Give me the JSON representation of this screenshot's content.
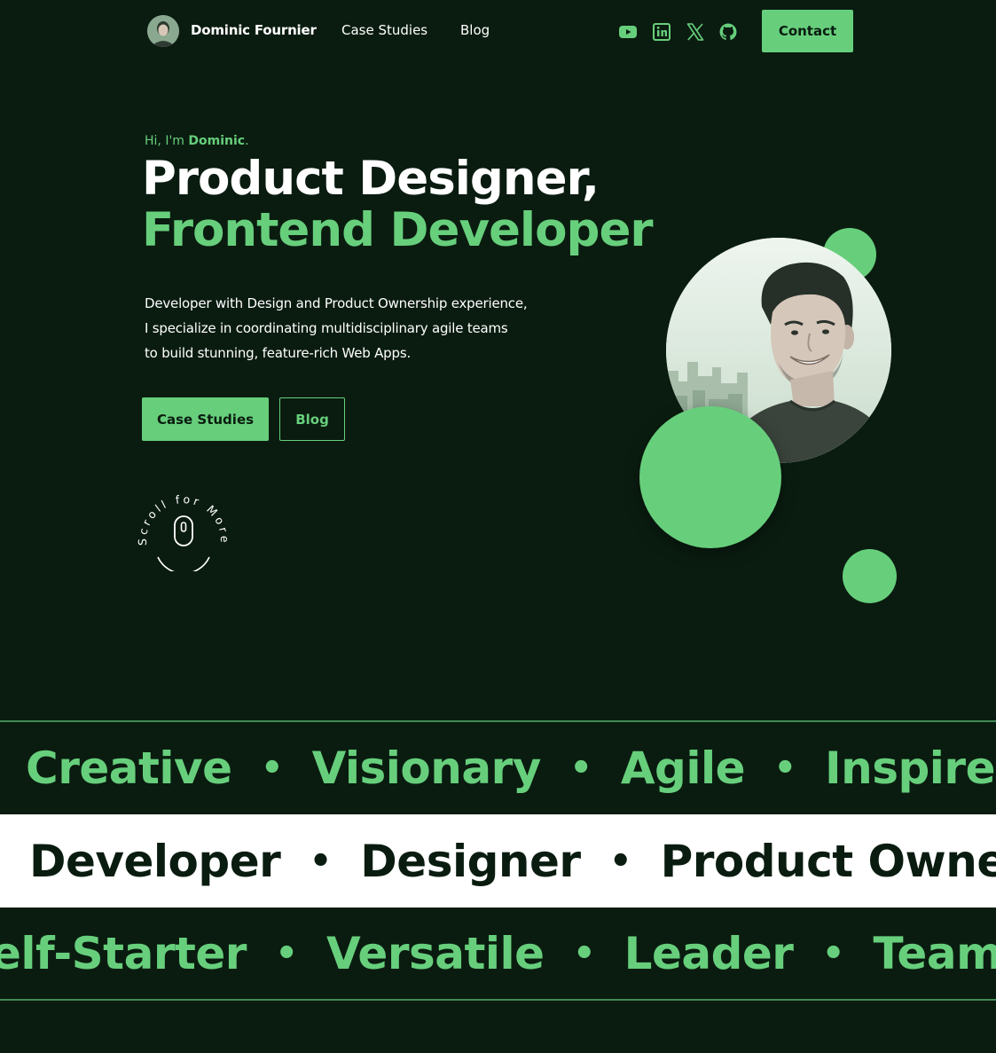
{
  "nav": {
    "brand": "Dominic Fournier",
    "links": [
      "Case Studies",
      "Blog"
    ],
    "socials": [
      "youtube-icon",
      "linkedin-icon",
      "x-icon",
      "github-icon"
    ],
    "contact_label": "Contact"
  },
  "hero": {
    "greeting_prefix": "Hi, I'm ",
    "greeting_name": "Dominic",
    "greeting_suffix": ".",
    "title_line1": "Product Designer,",
    "title_line2": "Frontend Developer",
    "intro_lines": [
      "Developer with Design and Product Ownership experience,",
      "I specialize in coordinating multidisciplinary agile teams",
      "to build stunning, feature-rich Web Apps."
    ],
    "primary_button": "Case Studies",
    "secondary_button": "Blog",
    "scroll_text": "Scroll for More"
  },
  "bands": [
    {
      "words": [
        "Creative",
        "Visionary",
        "Agile",
        "Inspired"
      ]
    },
    {
      "words": [
        "Developer",
        "Designer",
        "Product Owner"
      ]
    },
    {
      "words": [
        "elf-Starter",
        "Versatile",
        "Leader",
        "Team Pla"
      ]
    }
  ],
  "colors": {
    "background": "#0a1c10",
    "accent": "#67cf7c",
    "text": "#ffffff"
  }
}
